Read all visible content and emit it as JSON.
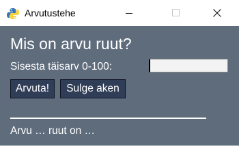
{
  "window": {
    "title": "Arvutustehe",
    "icon": "python-feather-icon"
  },
  "titlebar_controls": {
    "minimize_icon": "minimize-icon",
    "maximize_icon": "maximize-icon",
    "close_icon": "close-icon"
  },
  "main": {
    "heading": "Mis on arvu ruut?",
    "prompt_label": "Sisesta täisarv 0-100:",
    "input": {
      "value": "",
      "placeholder": ""
    },
    "buttons": {
      "guess_label": "Arvuta!",
      "close_label": "Sulge aken"
    },
    "result_text": "Arvu … ruut on …"
  },
  "colors": {
    "background": "#5f6c7c",
    "button_bg": "#2f3d57",
    "text": "#ffffff"
  }
}
